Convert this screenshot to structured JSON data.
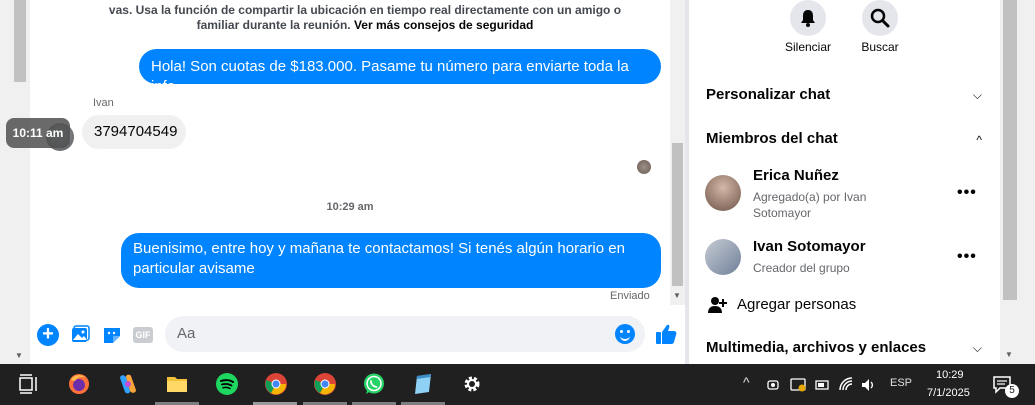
{
  "chat": {
    "notice_text": "vas. Usa la función de compartir la ubicación en tiempo real directamente con un amigo o familiar durante la reunión.",
    "notice_link": "Ver más consejos de seguridad",
    "messages": [
      {
        "text": "Hola! Son cuotas de $183.000. Pasame tu número para enviarte toda la info"
      },
      {
        "sender": "Ivan",
        "text": "3794704549",
        "time_tooltip": "10:11 am"
      },
      {
        "text": "Buenisimo, entre hoy y mañana te contactamos! Si tenés algún horario en particular avisame"
      }
    ],
    "timestamp": "10:29 am",
    "status": "Enviado",
    "composer_placeholder": "Aa",
    "gif_label": "GIF"
  },
  "side_panel": {
    "mute_label": "Silenciar",
    "search_label": "Buscar",
    "customize_label": "Personalizar chat",
    "members_label": "Miembros del chat",
    "members": [
      {
        "name": "Erica Nuñez",
        "subtitle": "Agregado(a) por Ivan Sotomayor"
      },
      {
        "name": "Ivan Sotomayor",
        "subtitle": "Creador del grupo"
      }
    ],
    "more_label": "•••",
    "add_people_label": "Agregar personas",
    "media_label": "Multimedia, archivos y enlaces"
  },
  "taskbar": {
    "lang": "ESP",
    "time": "10:29",
    "date": "7/1/2025",
    "notifications": "5"
  },
  "colors": {
    "accent": "#0084ff",
    "taskbar": "#202020"
  }
}
